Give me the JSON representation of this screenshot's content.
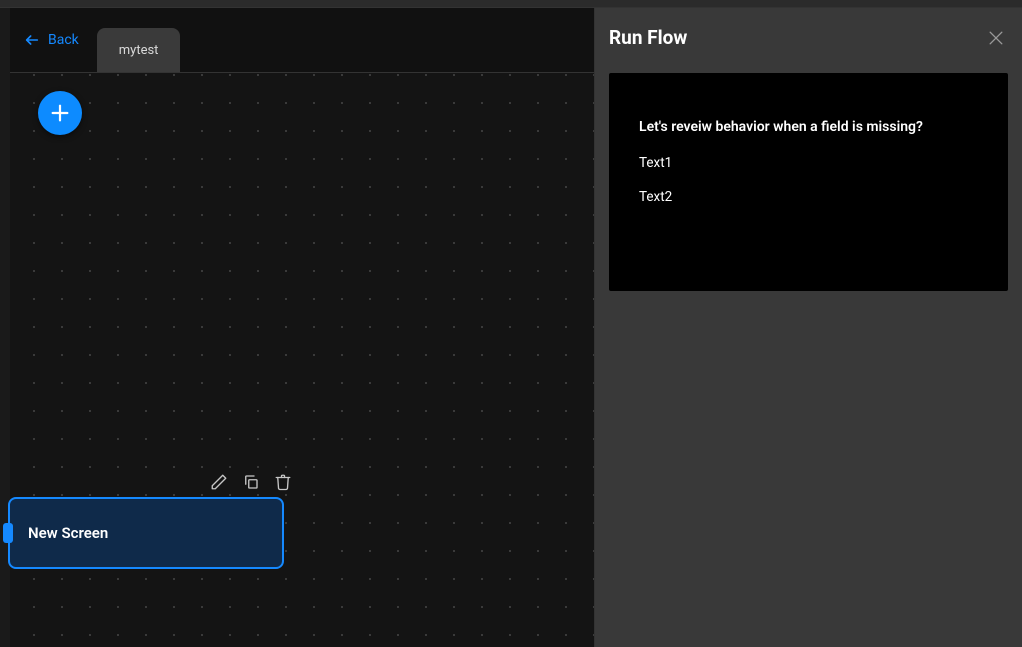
{
  "header": {
    "back_label": "Back",
    "tab_label": "mytest"
  },
  "canvas": {
    "screen_node_label": "New Screen"
  },
  "side_panel": {
    "title": "Run Flow",
    "preview": {
      "heading": "Let's reveiw behavior when a field is missing?",
      "lines": [
        "Text1",
        "Text2"
      ]
    }
  }
}
